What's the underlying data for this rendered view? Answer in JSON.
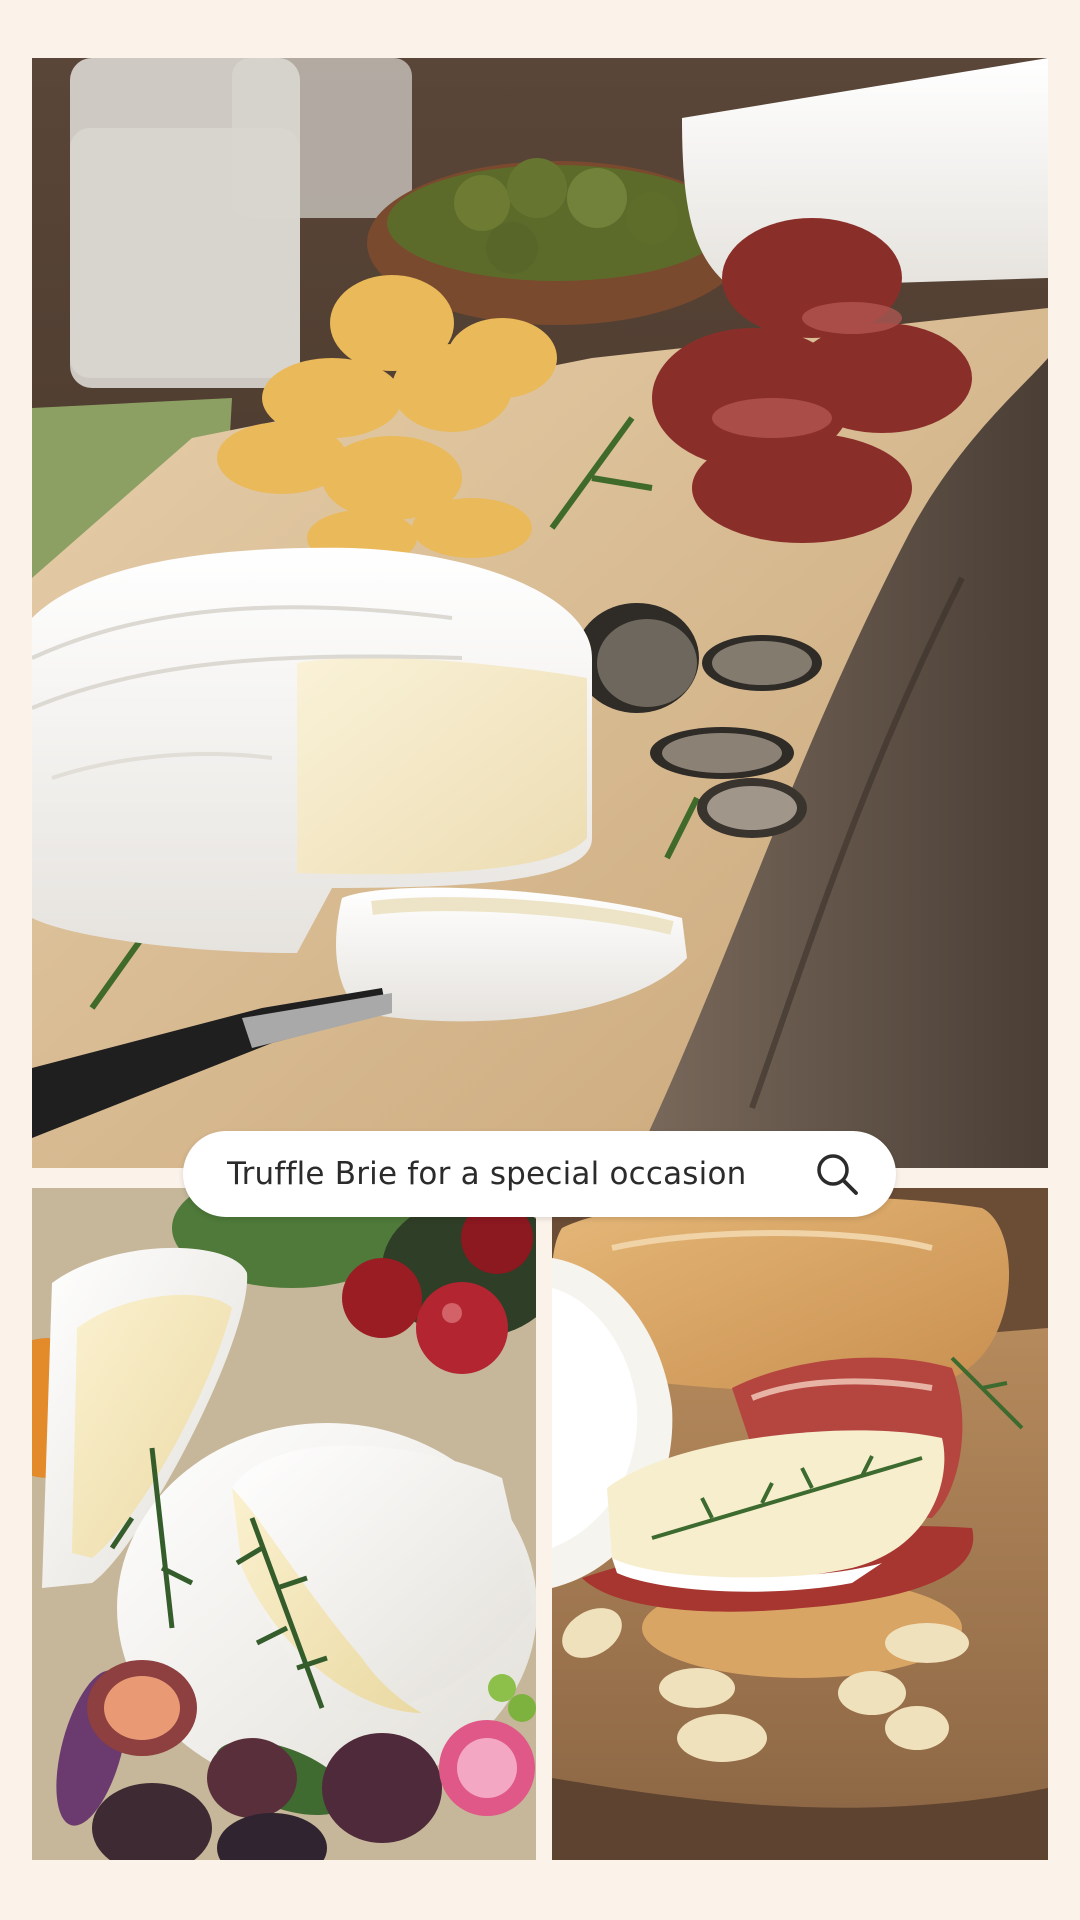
{
  "search": {
    "query": "Truffle Brie for a special occasion",
    "icon": "search-icon"
  },
  "photos": [
    {
      "name": "brie-board-hero",
      "subject": "Truffle brie wheel with chips, olives, cured meat and truffle slices on a wooden board"
    },
    {
      "name": "brie-fruit-platter",
      "subject": "Brie wedges with cherries, figs, herbs and flowers"
    },
    {
      "name": "brie-crostini",
      "subject": "Brie and prosciutto crostini with thyme, bread and almonds"
    }
  ],
  "colors": {
    "background": "#fbf3ea",
    "search_bg": "#ffffff",
    "search_text": "#2b2b2b",
    "icon": "#2b2b2b"
  }
}
